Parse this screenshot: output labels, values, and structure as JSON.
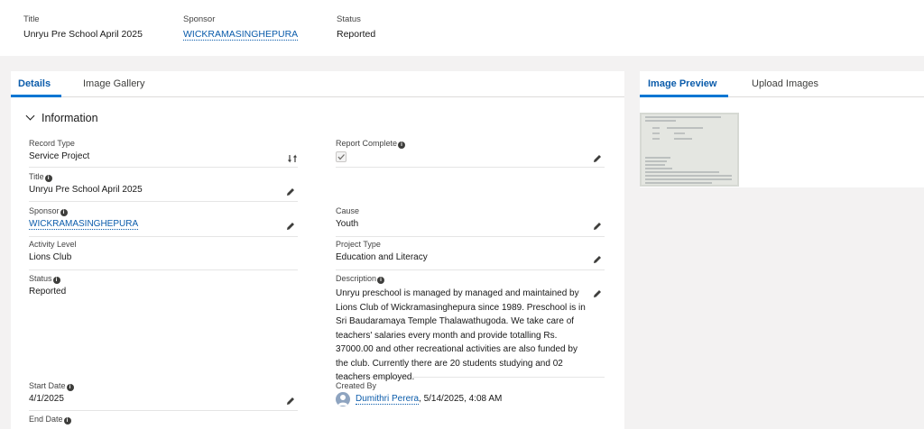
{
  "highlights": {
    "title_label": "Title",
    "title_value": "Unryu Pre School April 2025",
    "sponsor_label": "Sponsor",
    "sponsor_value": "WICKRAMASINGHEPURA",
    "status_label": "Status",
    "status_value": "Reported"
  },
  "main_tabs": [
    "Details",
    "Image Gallery"
  ],
  "section_title": "Information",
  "info_mark": "i",
  "fields": {
    "record_type": {
      "label": "Record Type",
      "value": "Service Project"
    },
    "report_complete": {
      "label": "Report Complete",
      "checked": true
    },
    "title": {
      "label": "Title",
      "value": "Unryu Pre School April 2025"
    },
    "sponsor": {
      "label": "Sponsor",
      "value": "WICKRAMASINGHEPURA"
    },
    "cause": {
      "label": "Cause",
      "value": "Youth"
    },
    "activity_level": {
      "label": "Activity Level",
      "value": "Lions Club"
    },
    "project_type": {
      "label": "Project Type",
      "value": "Education and Literacy"
    },
    "status": {
      "label": "Status",
      "value": "Reported"
    },
    "description": {
      "label": "Description",
      "value": "Unryu preschool is managed by managed and maintained by Lions Club of Wickramasinghepura since 1989. Preschool is in Sri Baudaramaya Temple Thalawathugoda. We take care of teachers' salaries every month and provide totalling Rs. 37000.00 and other recreational activities are also funded by the club. Currently there are 20 students studying and 02 teachers employed."
    },
    "start_date": {
      "label": "Start Date",
      "value": "4/1/2025"
    },
    "created_by": {
      "label": "Created By",
      "user": "Dumithri Perera",
      "timestamp": ", 5/14/2025, 4:08 AM"
    },
    "end_date": {
      "label": "End Date"
    }
  },
  "side_tabs": [
    "Image Preview",
    "Upload Images"
  ],
  "icons": {
    "pencil": "pencil-icon",
    "info": "info-icon",
    "chevron": "chevron-down-icon",
    "change_record_type": "change-record-type-icon",
    "avatar": "user-avatar-icon"
  },
  "colors": {
    "accent": "#0176d3",
    "link": "#0b5cab",
    "page_background": "#f3f2f2"
  }
}
